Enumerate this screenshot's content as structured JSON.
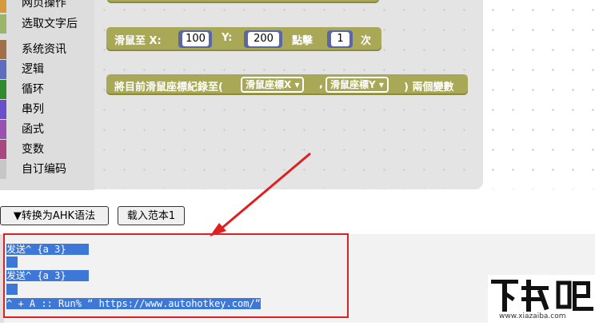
{
  "categories": [
    {
      "label": "网页操作",
      "color": "#d69a3c"
    },
    {
      "label": "选取文字后",
      "color": "#9bb56b"
    },
    {
      "label": "系统资讯",
      "color": "#a07048"
    },
    {
      "label": "逻辑",
      "color": "#5e6dc0"
    },
    {
      "label": "循环",
      "color": "#2e8b2e"
    },
    {
      "label": "串列",
      "color": "#6a50c8"
    },
    {
      "label": "函式",
      "color": "#9a52b0"
    },
    {
      "label": "变数",
      "color": "#a8487e"
    },
    {
      "label": "自订编码",
      "color": "#c7c7c7"
    }
  ],
  "blocks": {
    "move": {
      "prefix": "滑鼠至 X:",
      "x": "100",
      "y_label": "Y:",
      "y": "200",
      "click_label": "點擊",
      "count": "1",
      "suffix": "次"
    },
    "record": {
      "prefix": "將目前滑鼠座標紀錄至(",
      "var_x": "滑鼠座標X",
      "comma": ",",
      "var_y": "滑鼠座標Y",
      "suffix": ") 兩個變數"
    }
  },
  "buttons": {
    "convert": "▼转换为AHK语法",
    "load": "载入范本1"
  },
  "code_lines": [
    "发送^ {a 3}",
    "",
    "发送^ {a 3}",
    "",
    "^ + A :: Run% “ https://www.autohotkey.com/”"
  ],
  "watermark": {
    "brand": "下载吧",
    "url": "www.xiazaiba.com"
  }
}
